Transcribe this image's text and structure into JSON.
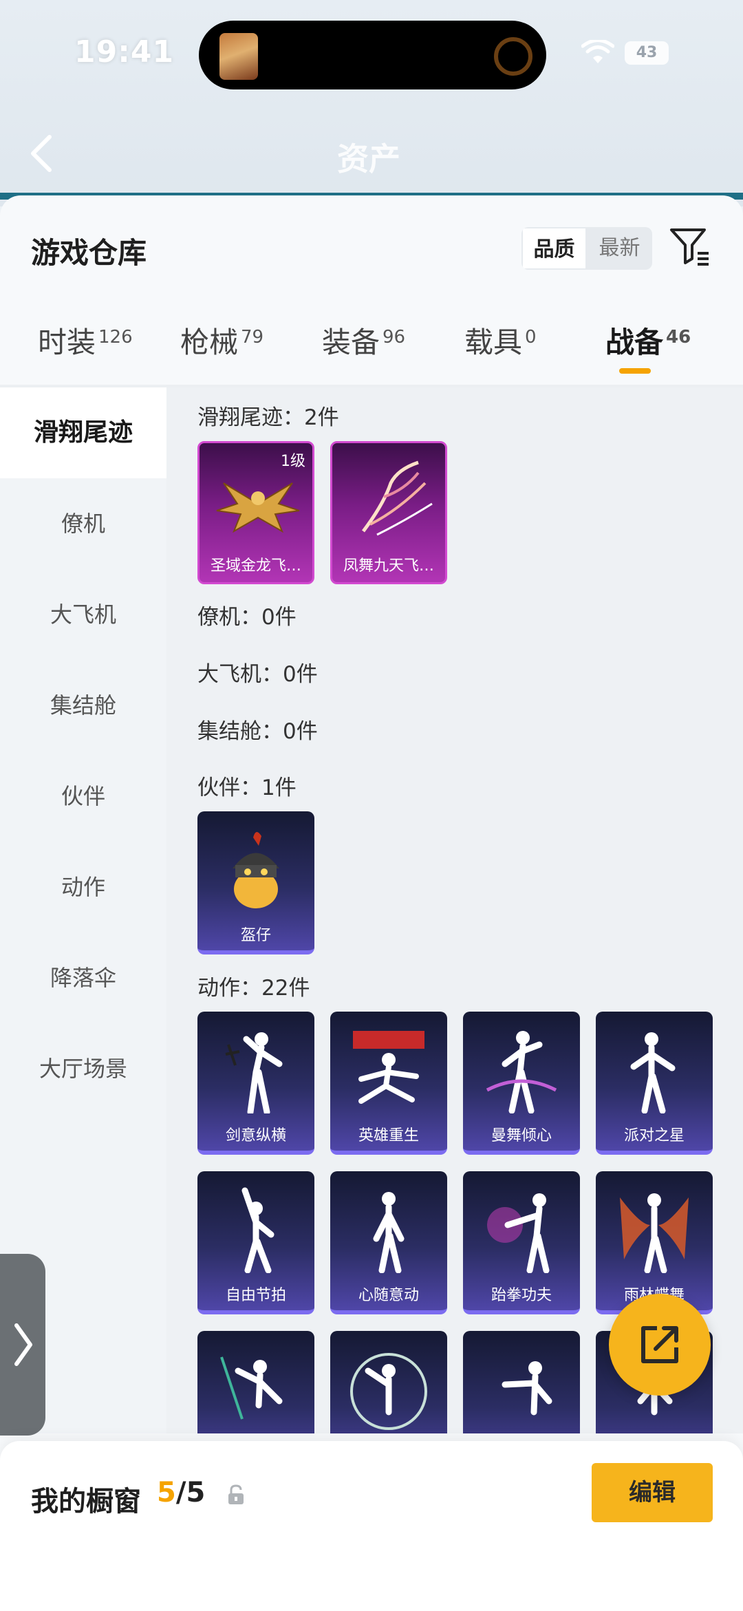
{
  "status_bar": {
    "time": "19:41",
    "battery": "43"
  },
  "header": {
    "title": "资产"
  },
  "sheet": {
    "title": "游戏仓库",
    "sort_options": [
      "品质",
      "最新"
    ],
    "tabs": [
      {
        "label": "时装",
        "count": "126"
      },
      {
        "label": "枪械",
        "count": "79"
      },
      {
        "label": "装备",
        "count": "96"
      },
      {
        "label": "载具",
        "count": "0"
      },
      {
        "label": "战备",
        "count": "46"
      }
    ],
    "active_tab": "战备"
  },
  "sidebar": {
    "items": [
      "滑翔尾迹",
      "僚机",
      "大飞机",
      "集结舱",
      "伙伴",
      "动作",
      "降落伞",
      "大厅场景"
    ],
    "active": "滑翔尾迹"
  },
  "content": {
    "sections": [
      {
        "label": "滑翔尾迹：2件",
        "items": [
          {
            "name": "圣域金龙飞…",
            "level": "1级"
          },
          {
            "name": "凤舞九天飞…"
          }
        ]
      },
      {
        "label": "僚机：0件",
        "items": []
      },
      {
        "label": "大飞机：0件",
        "items": []
      },
      {
        "label": "集结舱：0件",
        "items": []
      },
      {
        "label": "伙伴：1件",
        "items": [
          {
            "name": "盔仔"
          }
        ]
      },
      {
        "label": "动作：22件",
        "items": [
          {
            "name": "剑意纵横"
          },
          {
            "name": "英雄重生"
          },
          {
            "name": "曼舞倾心"
          },
          {
            "name": "派对之星"
          },
          {
            "name": "自由节拍"
          },
          {
            "name": "心随意动"
          },
          {
            "name": "跆拳功夫"
          },
          {
            "name": "雨林蝶舞"
          }
        ]
      }
    ]
  },
  "bottom_bar": {
    "label": "我的橱窗",
    "current": "5",
    "separator": "/",
    "total": "5",
    "edit_label": "编辑"
  },
  "colors": {
    "accent": "#f5a300",
    "fab": "#f6b41c",
    "card_purple": "#2b2d63",
    "card_magenta": "#8a1f93"
  }
}
